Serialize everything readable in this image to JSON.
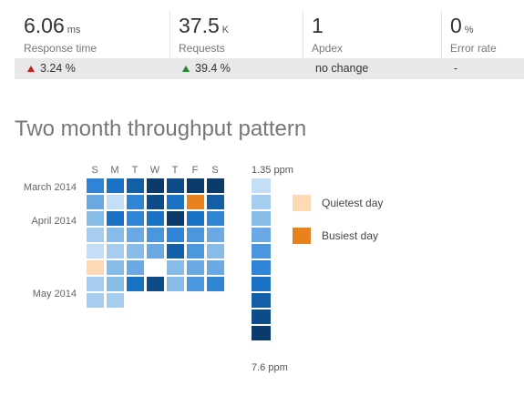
{
  "metrics": [
    {
      "value": "6.06",
      "unit": "ms",
      "label": "Response time",
      "change": "3.24 %",
      "trend": "up-red"
    },
    {
      "value": "37.5",
      "unit": "K",
      "label": "Requests",
      "change": "39.4 %",
      "trend": "up-green"
    },
    {
      "value": "1",
      "unit": "",
      "label": "Apdex",
      "change": "no change",
      "trend": "none"
    },
    {
      "value": "0",
      "unit": "%",
      "label": "Error rate",
      "change": "-",
      "trend": "none"
    }
  ],
  "throughput": {
    "title": "Two month throughput pattern",
    "day_labels": [
      "S",
      "M",
      "T",
      "W",
      "T",
      "F",
      "S"
    ],
    "month_labels": [
      "March 2014",
      "April 2014",
      "May 2014"
    ],
    "scale_min_label": "1.35 ppm",
    "scale_max_label": "7.6 ppm",
    "legend": {
      "quietest": "Quietest day",
      "busiest": "Busiest day"
    },
    "colors": {
      "quietest": "#fdd9b4",
      "busiest": "#e8821f",
      "levels": [
        "#c3def5",
        "#a6cdef",
        "#87bce9",
        "#6aa9e4",
        "#4b97de",
        "#2f84d6",
        "#1a72c5",
        "#125fa8",
        "#0d4c88",
        "#0a3b6a"
      ]
    },
    "weeks": [
      [
        5,
        6,
        7,
        9,
        8,
        9,
        9
      ],
      [
        3,
        0,
        5,
        8,
        6,
        7,
        7
      ],
      [
        2,
        6,
        5,
        6,
        9,
        6,
        5
      ],
      [
        1,
        2,
        3,
        4,
        5,
        4,
        3
      ],
      [
        0,
        1,
        2,
        3,
        7,
        4,
        2
      ],
      [
        "quiet",
        2,
        3,
        null,
        2,
        3,
        3
      ],
      [
        1,
        2,
        6,
        8,
        2,
        4,
        5
      ],
      [
        1,
        1,
        null,
        null,
        null,
        null,
        null
      ]
    ],
    "busiest_cell": {
      "week": 1,
      "day": 5
    }
  }
}
